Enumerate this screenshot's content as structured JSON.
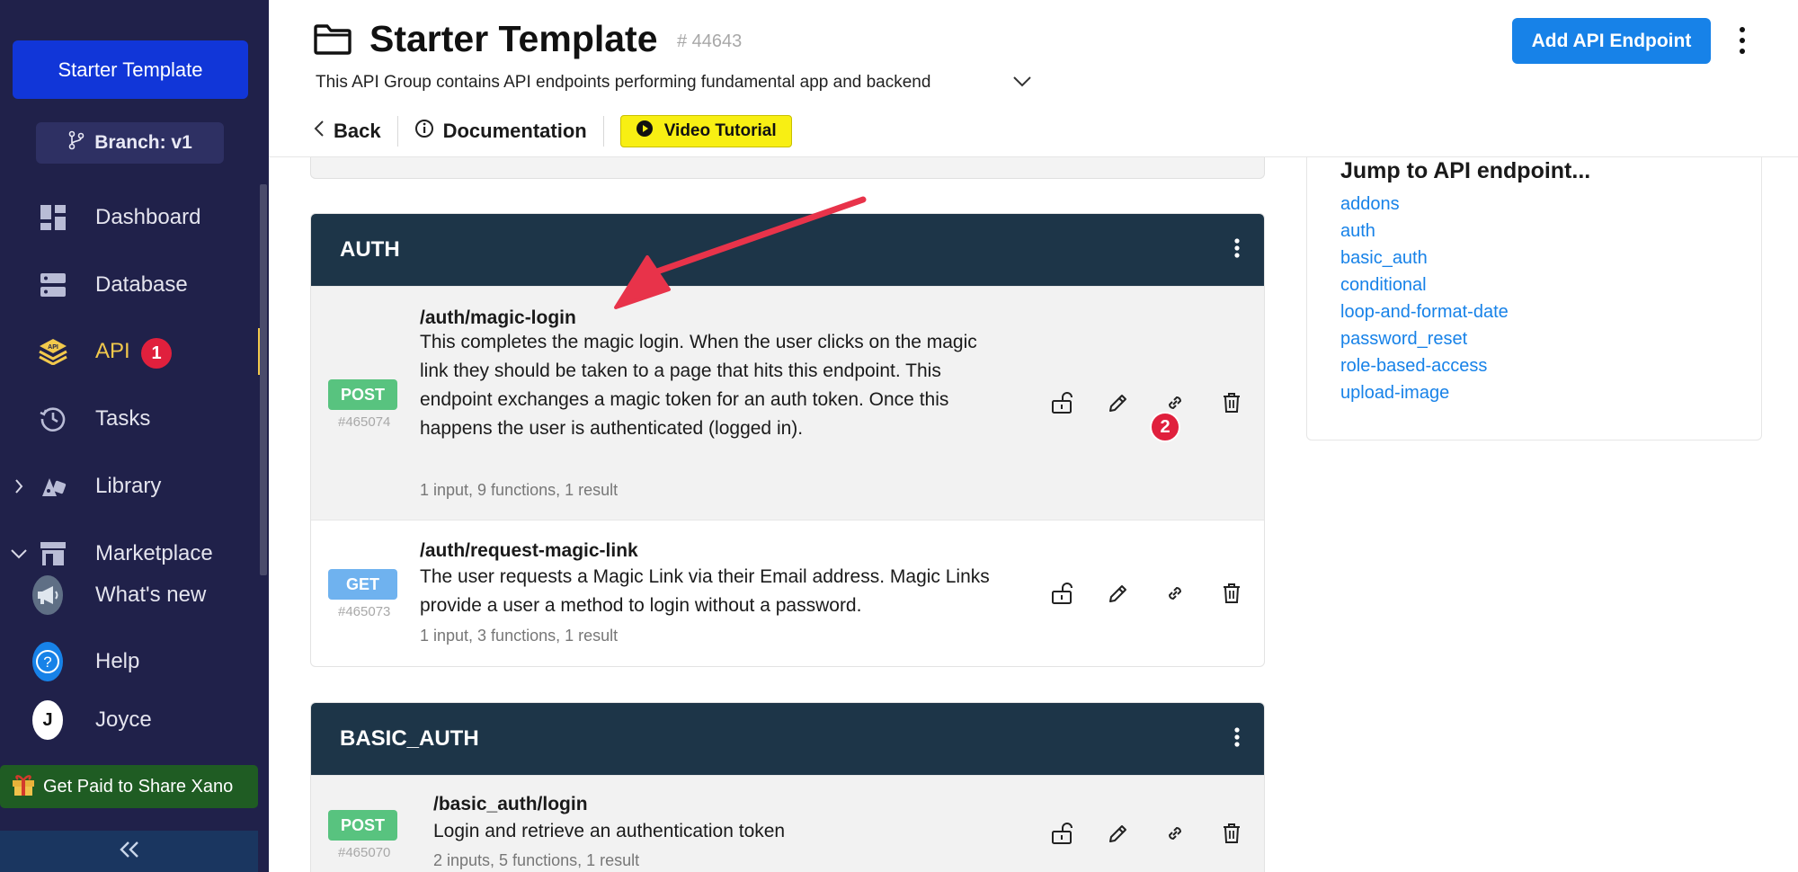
{
  "sidebar": {
    "project_label": "Starter Template",
    "branch_label": "Branch: v1",
    "items": [
      {
        "label": "Dashboard"
      },
      {
        "label": "Database"
      },
      {
        "label": "API",
        "badge": "1"
      },
      {
        "label": "Tasks"
      },
      {
        "label": "Library"
      },
      {
        "label": "Marketplace"
      },
      {
        "label": "What's new"
      },
      {
        "label": "Help"
      },
      {
        "label": "Joyce",
        "avatar_letter": "J"
      }
    ],
    "promo_label": "Get Paid to Share Xano"
  },
  "header": {
    "title": "Starter Template",
    "id": "# 44643",
    "description": "This API Group contains API endpoints performing fundamental app and backend",
    "back_label": "Back",
    "documentation_label": "Documentation",
    "video_label": "Video Tutorial",
    "add_button_label": "Add API Endpoint"
  },
  "groups": [
    {
      "name": "AUTH",
      "endpoints": [
        {
          "method": "POST",
          "id": "#465074",
          "path": "/auth/magic-login",
          "description": "This completes the magic login. When the user clicks on the magic link they should be taken to a page that hits this endpoint. This endpoint exchanges a magic token for an auth token. Once this happens the user is authenticated (logged in).",
          "meta": "1 input, 9 functions, 1 result",
          "badge": "2"
        },
        {
          "method": "GET",
          "id": "#465073",
          "path": "/auth/request-magic-link",
          "description": "The user requests a Magic Link via their Email address. Magic Links provide a user a method to login without a password.",
          "meta": "1 input, 3 functions, 1 result"
        }
      ]
    },
    {
      "name": "BASIC_AUTH",
      "endpoints": [
        {
          "method": "POST",
          "id": "#465070",
          "path": "/basic_auth/login",
          "description": "Login and retrieve an authentication token",
          "meta": "2 inputs, 5 functions, 1 result"
        }
      ]
    }
  ],
  "jump": {
    "title": "Jump to API endpoint...",
    "links": [
      "addons",
      "auth",
      "basic_auth",
      "conditional",
      "loop-and-format-date",
      "password_reset",
      "role-based-access",
      "upload-image"
    ]
  },
  "colors": {
    "sidebar_bg": "#20214a",
    "active_accent": "#f2c94c",
    "primary": "#1782e8",
    "group_header": "#1d3548",
    "post": "#58c37f",
    "get": "#6fb2ef",
    "badge_red": "#e0203d",
    "video_yellow": "#f8ef13"
  }
}
